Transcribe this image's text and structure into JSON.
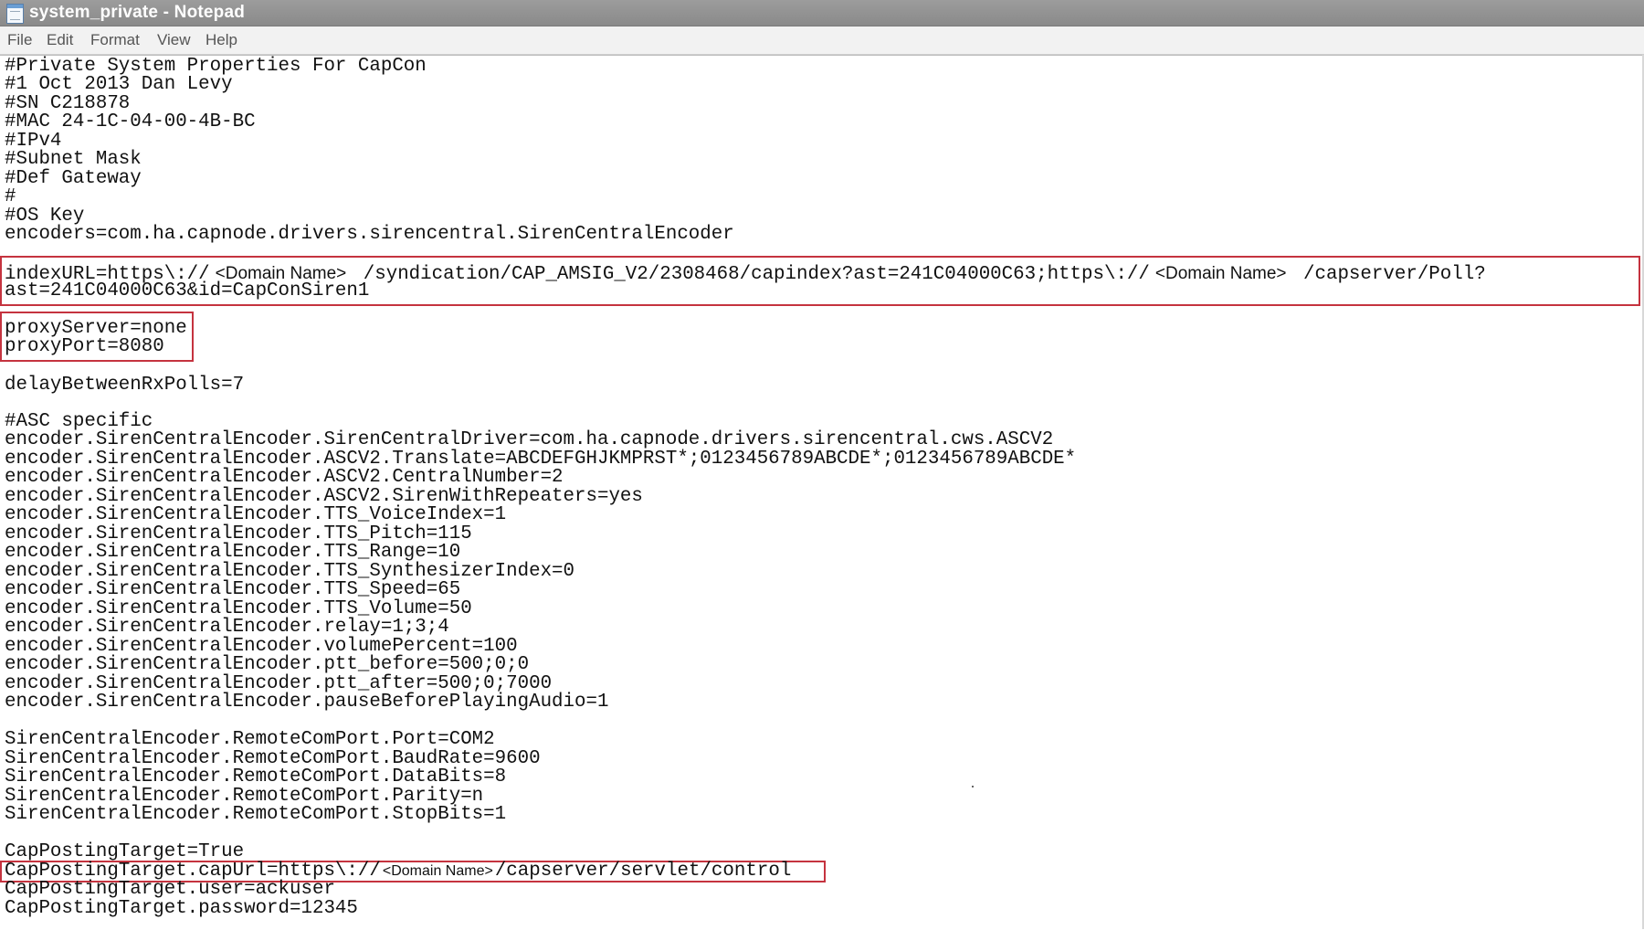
{
  "window": {
    "title": "system_private - Notepad",
    "icon": "notepad-icon"
  },
  "menu": {
    "file": "File",
    "edit": "Edit",
    "format": "Format",
    "view": "View",
    "help": "Help"
  },
  "editor": {
    "line1": "#Private System Properties For CapCon",
    "line2": "#1 Oct 2013 Dan Levy",
    "line3": "#SN C218878",
    "line4": "#MAC 24-1C-04-00-4B-BC",
    "line5": "#IPv4",
    "line6": "#Subnet Mask",
    "line7": "#Def Gateway",
    "line8": "#",
    "line9": "#OS Key",
    "line10": "encoders=com.ha.capnode.drivers.sirencentral.SirenCentralEncoder",
    "index_url_a": "indexURL=https\\://",
    "domain_name_1": "<Domain Name>",
    "index_url_b": " /syndication/CAP_AMSIG_V2/2308468/capindex?ast=241C04000C63;https\\://",
    "domain_name_2": "<Domain Name>",
    "index_url_c": " /capserver/Poll?",
    "index_url_d": "ast=241C04000C63&id=CapConSiren1",
    "proxy_server": "proxyServer=none",
    "proxy_port": "proxyPort=8080",
    "delay": "delayBetweenRxPolls=7",
    "asc_comment": "#ASC specific",
    "enc1": "encoder.SirenCentralEncoder.SirenCentralDriver=com.ha.capnode.drivers.sirencentral.cws.ASCV2",
    "enc2": "encoder.SirenCentralEncoder.ASCV2.Translate=ABCDEFGHJKMPRST*;0123456789ABCDE*;0123456789ABCDE*",
    "enc3": "encoder.SirenCentralEncoder.ASCV2.CentralNumber=2",
    "enc4": "encoder.SirenCentralEncoder.ASCV2.SirenWithRepeaters=yes",
    "enc5": "encoder.SirenCentralEncoder.TTS_VoiceIndex=1",
    "enc6": "encoder.SirenCentralEncoder.TTS_Pitch=115",
    "enc7": "encoder.SirenCentralEncoder.TTS_Range=10",
    "enc8": "encoder.SirenCentralEncoder.TTS_SynthesizerIndex=0",
    "enc9": "encoder.SirenCentralEncoder.TTS_Speed=65",
    "enc10": "encoder.SirenCentralEncoder.TTS_Volume=50",
    "enc11": "encoder.SirenCentralEncoder.relay=1;3;4",
    "enc12": "encoder.SirenCentralEncoder.volumePercent=100",
    "enc13": "encoder.SirenCentralEncoder.ptt_before=500;0;0",
    "enc14": "encoder.SirenCentralEncoder.ptt_after=500;0;7000",
    "enc15": "encoder.SirenCentralEncoder.pauseBeforePlayingAudio=1",
    "port1": "SirenCentralEncoder.RemoteComPort.Port=COM2",
    "port2": "SirenCentralEncoder.RemoteComPort.BaudRate=9600",
    "port3": "SirenCentralEncoder.RemoteComPort.DataBits=8",
    "port4": "SirenCentralEncoder.RemoteComPort.Parity=n",
    "port5": "SirenCentralEncoder.RemoteComPort.StopBits=1",
    "cap1": "CapPostingTarget=True",
    "cap_url_a": "CapPostingTarget.capUrl=https\\://",
    "domain_name_3": "<Domain Name>",
    "cap_url_b": "/capserver/servlet/control",
    "cap3": "CapPostingTarget.user=ackuser",
    "cap4": "CapPostingTarget.password=12345"
  }
}
